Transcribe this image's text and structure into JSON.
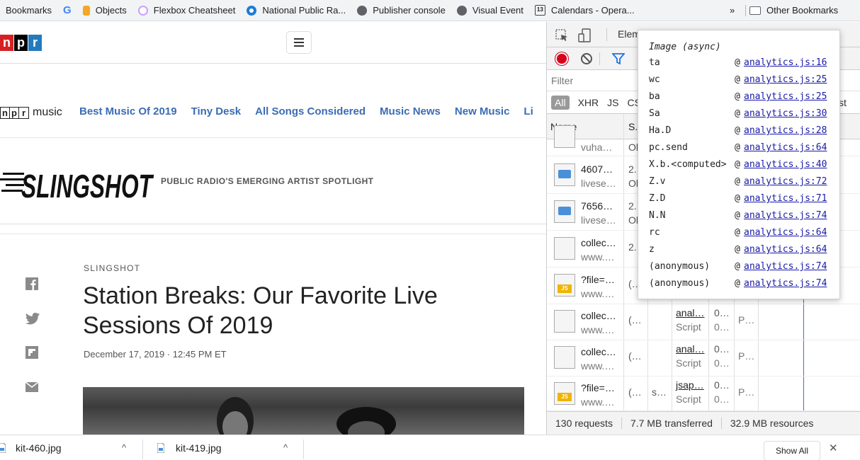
{
  "bookmarks": {
    "items": [
      {
        "label": "Bookmarks",
        "icon": "bookmarks-icon"
      },
      {
        "label": "",
        "icon": "google-icon"
      },
      {
        "label": "Objects",
        "icon": "objects-icon"
      },
      {
        "label": "Flexbox Cheatsheet",
        "icon": "flexbox-icon"
      },
      {
        "label": "National Public Ra...",
        "icon": "npr-icon"
      },
      {
        "label": "Publisher console",
        "icon": "globe-icon"
      },
      {
        "label": "Visual Event",
        "icon": "globe-icon"
      },
      {
        "label": "Calendars - Opera...",
        "icon": "calendar-icon"
      }
    ],
    "overflow": "»",
    "other": "Other Bookmarks",
    "calendar_day": "13",
    "google_letter": "G"
  },
  "page": {
    "logo_letters": [
      "n",
      "p",
      "r"
    ],
    "music_word": "music",
    "nav": [
      "Best Music Of 2019",
      "Tiny Desk",
      "All Songs Considered",
      "Music News",
      "New Music",
      "Li"
    ],
    "slingshot_logo": "SLINGSHOT",
    "tagline": "PUBLIC RADIO'S EMERGING ARTIST SPOTLIGHT",
    "kicker": "SLINGSHOT",
    "headline": "Station Breaks: Our Favorite Live Sessions Of 2019",
    "dateline": "December 17, 2019 · 12:45 PM ET"
  },
  "devtools": {
    "tab_partial": "Elem",
    "filter_placeholder": "Filter",
    "types": [
      "All",
      "XHR",
      "JS",
      "CS"
    ],
    "type_partial": "st",
    "columns": {
      "name": "Name",
      "status": "S."
    },
    "rows": [
      {
        "n1": "vuha…",
        "n2": "",
        "c1": "Ol",
        "c2": "",
        "c3": "",
        "c4": "",
        "c5": "",
        "c6": "",
        "c7": ""
      },
      {
        "n1": "4607…",
        "n2": "livese…",
        "c1": "2.",
        "c1b": "Ol",
        "c2": "",
        "c3": "",
        "c4": "",
        "c5": "",
        "c6": "",
        "c7": ""
      },
      {
        "n1": "7656…",
        "n2": "livese…",
        "c1": "2.",
        "c1b": "Ol",
        "c2": "",
        "c3": "",
        "c4": "",
        "c5": "",
        "c6": "",
        "c7": ""
      },
      {
        "n1": "collec…",
        "n2": "www.…",
        "c1": "2.",
        "c1b": "",
        "c2": "",
        "c3": "",
        "c4": "",
        "c5": "",
        "c6": "",
        "c7": ""
      },
      {
        "n1": "?file=…",
        "n2": "www.…",
        "c1": "(…",
        "c1b": "",
        "c2": "",
        "c3": "",
        "c4": "",
        "c5": "",
        "c6": "",
        "c7": ""
      },
      {
        "n1": "collec…",
        "n2": "www.…",
        "c1": "(…",
        "c1b": "",
        "c2": "",
        "c3": "anal…",
        "c4": "Script",
        "c5": "0…",
        "c6": "0…",
        "c7": "P…"
      },
      {
        "n1": "collec…",
        "n2": "www.…",
        "c1": "(…",
        "c1b": "",
        "c2": "",
        "c3": "anal…",
        "c4": "Script",
        "c5": "0…",
        "c6": "0…",
        "c7": "P…"
      },
      {
        "n1": "?file=…",
        "n2": "www.…",
        "c1": "(…",
        "c1b": "",
        "c2": "s…",
        "c3": "jsap…",
        "c4": "Script",
        "c5": "0…",
        "c6": "0…",
        "c7": "P…"
      }
    ],
    "status": [
      "130 requests",
      "7.7 MB transferred",
      "32.9 MB resources"
    ]
  },
  "popover": {
    "title": "Image (async)",
    "frames": [
      {
        "fn": "ta",
        "src": "analytics.js:16"
      },
      {
        "fn": "wc",
        "src": "analytics.js:25"
      },
      {
        "fn": "ba",
        "src": "analytics.js:25"
      },
      {
        "fn": "Sa",
        "src": "analytics.js:30"
      },
      {
        "fn": "Ha.D",
        "src": "analytics.js:28"
      },
      {
        "fn": "pc.send",
        "src": "analytics.js:64"
      },
      {
        "fn": "X.b.<computed>",
        "src": "analytics.js:40"
      },
      {
        "fn": "Z.v",
        "src": "analytics.js:72"
      },
      {
        "fn": "Z.D",
        "src": "analytics.js:71"
      },
      {
        "fn": "N.N",
        "src": "analytics.js:74"
      },
      {
        "fn": "rc",
        "src": "analytics.js:64"
      },
      {
        "fn": "z",
        "src": "analytics.js:64"
      },
      {
        "fn": "(anonymous)",
        "src": "analytics.js:74"
      },
      {
        "fn": "(anonymous)",
        "src": "analytics.js:74"
      }
    ],
    "at": "@"
  },
  "downloads": {
    "files": [
      "kit-460.jpg",
      "kit-419.jpg"
    ],
    "show_all": "Show All",
    "close": "✕",
    "chevron": "^"
  },
  "colors": {
    "npr_red": "#d62021",
    "npr_black": "#000000",
    "npr_blue": "#237bbd",
    "nav_blue": "#3a6cb5",
    "record_red": "#d9001b",
    "link_blue": "#1a1aa6"
  }
}
